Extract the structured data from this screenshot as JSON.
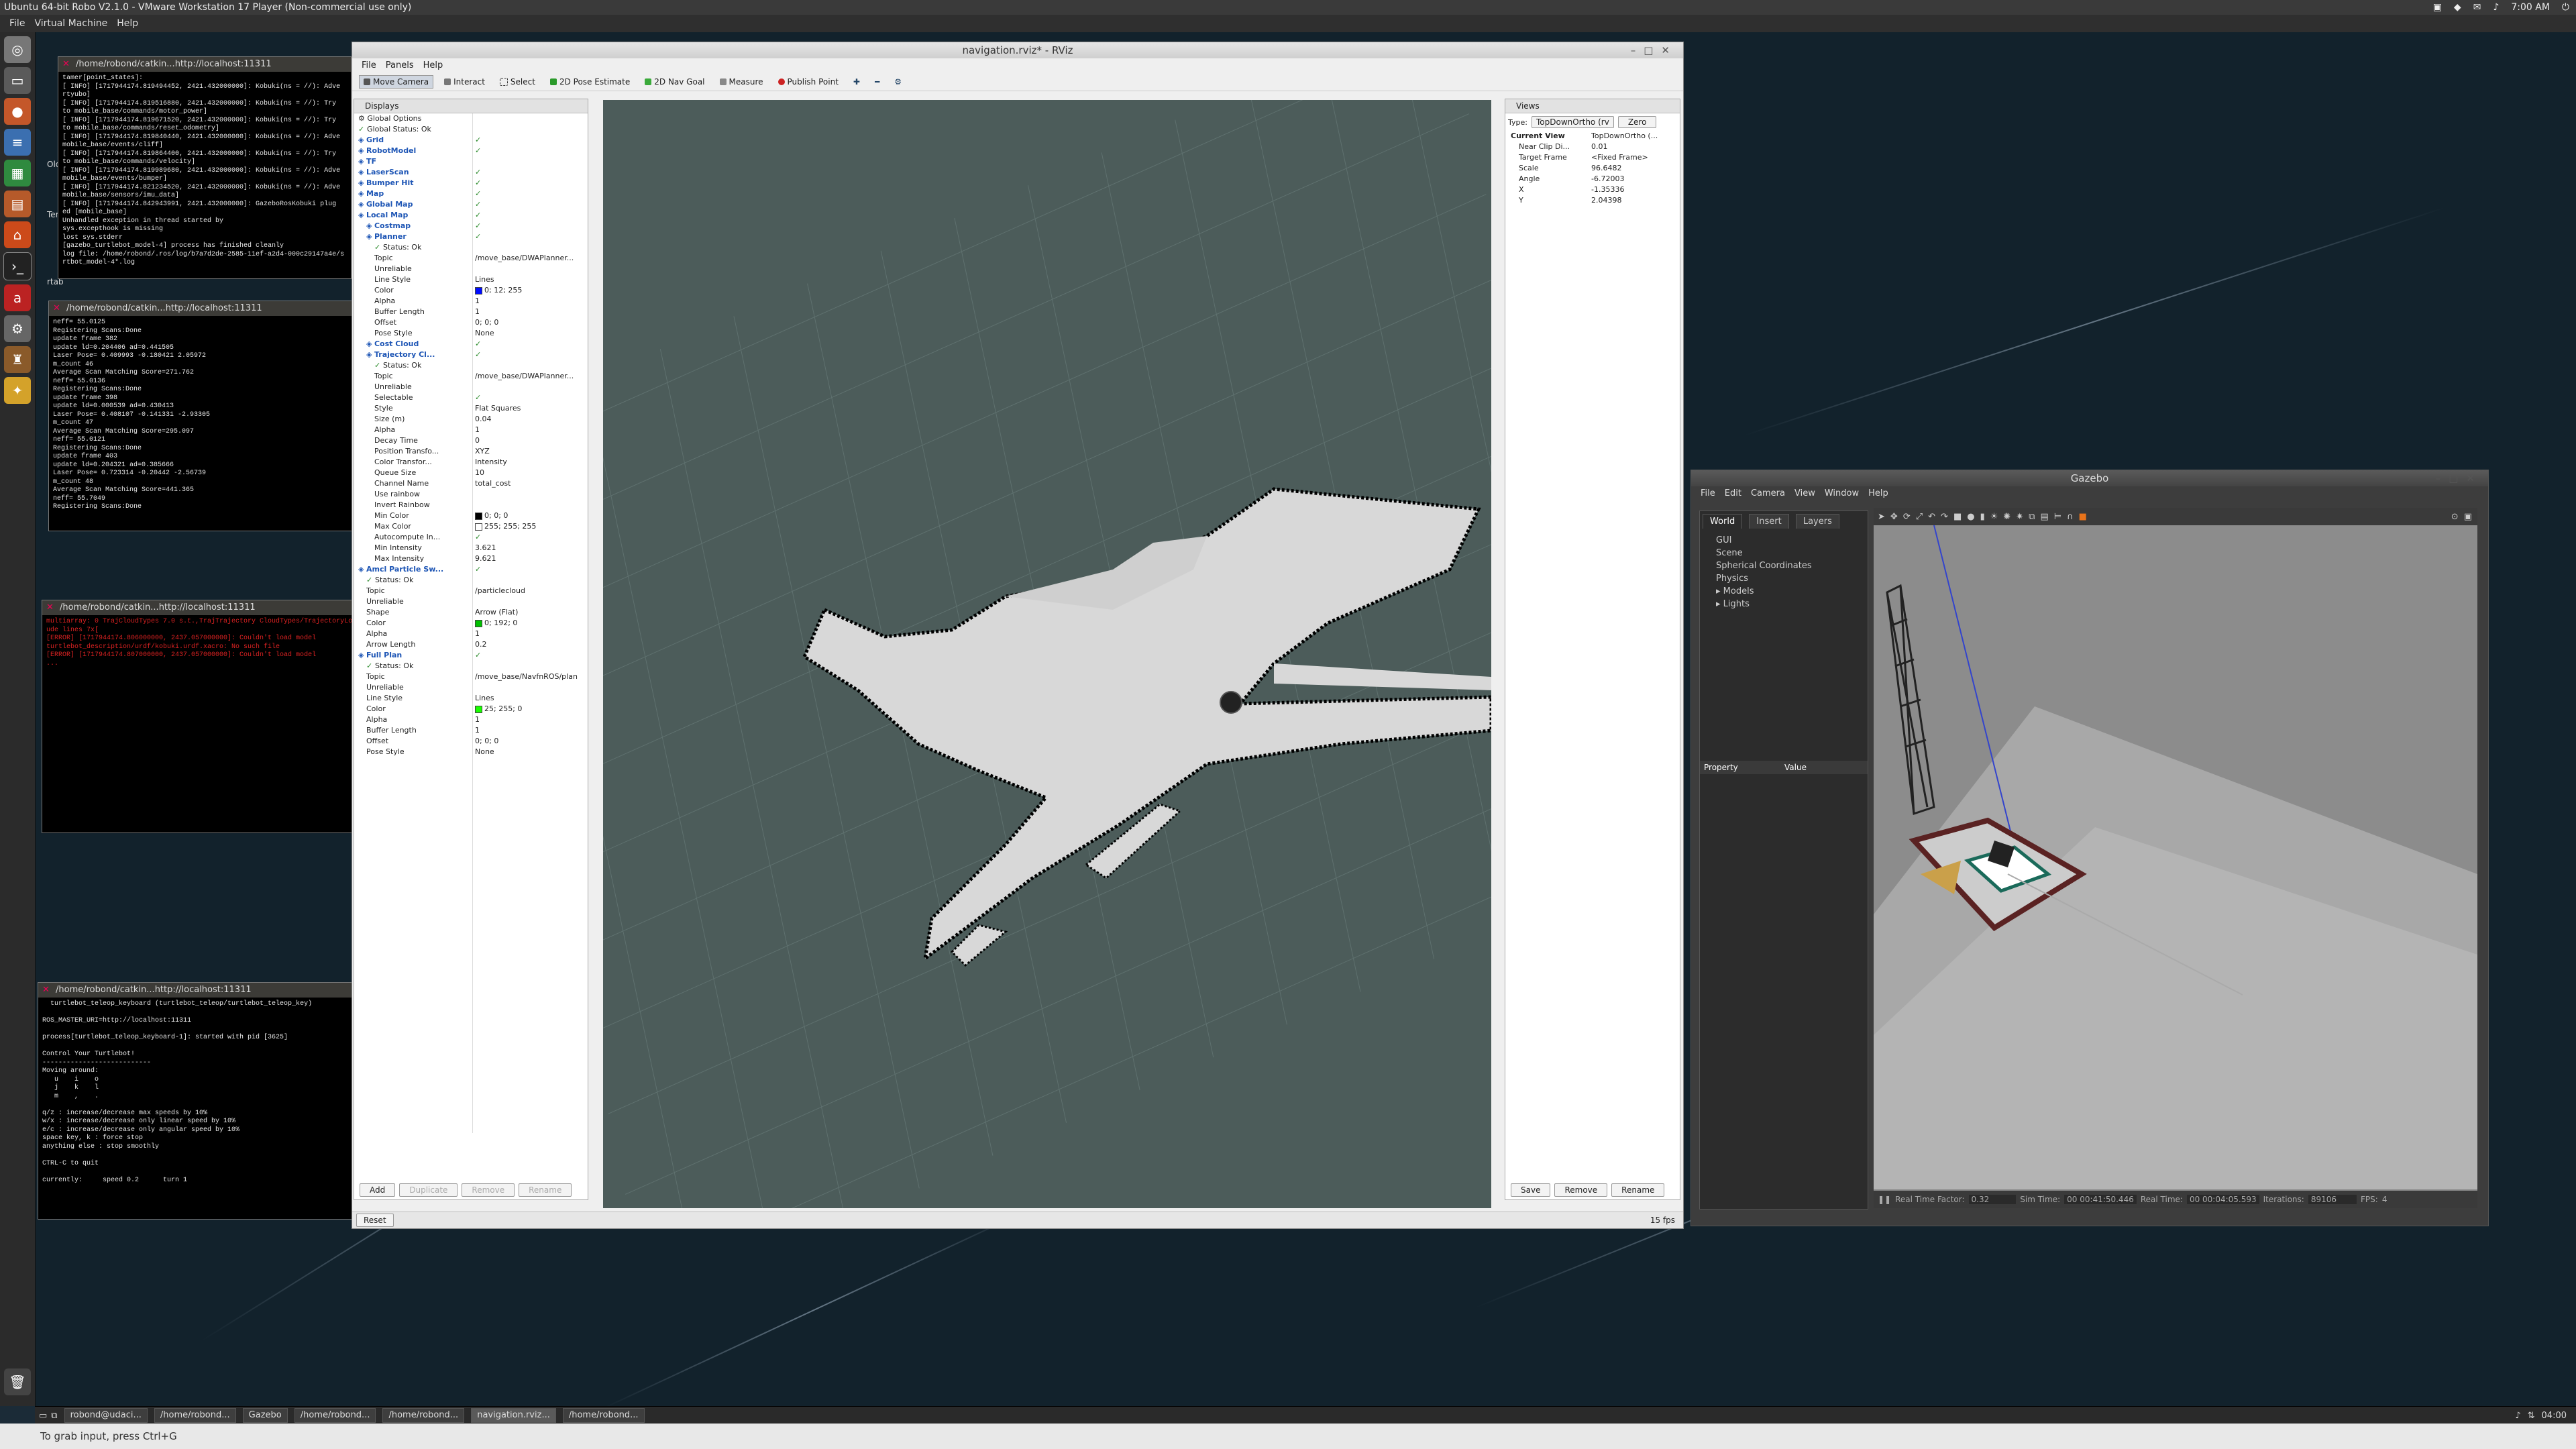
{
  "vm": {
    "title": "Ubuntu 64-bit Robo V2.1.0 - VMware Workstation 17 Player (Non-commercial use only)",
    "menu": [
      "File",
      "Virtual Machine",
      "Help"
    ],
    "clock": "7:00 AM"
  },
  "desktop": {
    "icon_labels": [
      "Old",
      "rtab",
      "Term",
      "Ty"
    ]
  },
  "terminals": [
    {
      "title": "/home/robond/catkin...http://localhost:11311",
      "lines": [
        "tamer[point_states]:",
        "[ INFO] [1717944174.819494452, 2421.432000000]: Kobuki(ns = //): Adve",
        "rtyubo]",
        "[ INFO] [1717944174.819516880, 2421.432000000]: Kobuki(ns = //): Try",
        "to mobile_base/commands/motor_power]",
        "[ INFO] [1717944174.819671520, 2421.432000000]: Kobuki(ns = //): Try",
        "to mobile_base/commands/reset_odometry]",
        "[ INFO] [1717944174.819840440, 2421.432000000]: Kobuki(ns = //): Adve",
        "mobile_base/events/cliff]",
        "[ INFO] [1717944174.819864400, 2421.432000000]: Kobuki(ns = //): Try",
        "to mobile_base/commands/velocity]",
        "[ INFO] [1717944174.819989680, 2421.432000000]: Kobuki(ns = //): Adve",
        "mobile_base/events/bumper]",
        "[ INFO] [1717944174.821234520, 2421.432000000]: Kobuki(ns = //): Adve",
        "mobile_base/sensors/imu_data]",
        "[ INFO] [1717944174.842943991, 2421.432000000]: GazeboRosKobuki plug",
        "ed [mobile_base]",
        "Unhandled exception in thread started by",
        "sys.excepthook is missing",
        "lost sys.stderr",
        "[gazebo_turtlebot_model-4] process has finished cleanly",
        "log file: /home/robond/.ros/log/b7a7d2de-2585-11ef-a2d4-000c29147a4e/s",
        "rtbot_model-4*.log"
      ]
    },
    {
      "title": "/home/robond/catkin...http://localhost:11311",
      "lines": [
        "neff= 55.0125",
        "Registering Scans:Done",
        "update frame 382",
        "update ld=0.204406 ad=0.441505",
        "Laser Pose= 0.409993 -0.180421 2.05972",
        "m_count 46",
        "Average Scan Matching Score=271.762",
        "neff= 55.0136",
        "Registering Scans:Done",
        "update frame 398",
        "update ld=0.000539 ad=0.430413",
        "Laser Pose= 0.408107 -0.141331 -2.93305",
        "m_count 47",
        "Average Scan Matching Score=295.097",
        "neff= 55.0121",
        "Registering Scans:Done",
        "update frame 403",
        "update ld=0.204321 ad=0.385666",
        "Laser Pose= 0.723314 -0.20442 -2.56739",
        "m_count 48",
        "Average Scan Matching Score=441.365",
        "neff= 55.7049",
        "Registering Scans:Done"
      ]
    },
    {
      "title": "/home/robond/catkin...http://localhost:11311",
      "lines": [
        "multiarray: 0 TrajCloudTypes 7.0 s.t.,TrajTrajectory CloudTypes/TrajectoryLocalization",
        "ude lines 7x[",
        "[ERROR] [1717944174.806000000, 2437.057000000]: Couldn't load model",
        "turtlebot_description/urdf/kobuki.urdf.xacro: No such file",
        "[ERROR] [1717944174.807000000, 2437.057000000]: Couldn't load model",
        "..."
      ]
    },
    {
      "title": "/home/robond/catkin...http://localhost:11311",
      "lines": [
        "  turtlebot_teleop_keyboard (turtlebot_teleop/turtlebot_teleop_key)",
        "",
        "ROS_MASTER_URI=http://localhost:11311",
        "",
        "process[turtlebot_teleop_keyboard-1]: started with pid [3625]",
        "",
        "Control Your Turtlebot!",
        "---------------------------",
        "Moving around:",
        "   u    i    o",
        "   j    k    l",
        "   m    ,    .",
        "",
        "q/z : increase/decrease max speeds by 10%",
        "w/x : increase/decrease only linear speed by 10%",
        "e/c : increase/decrease only angular speed by 10%",
        "space key, k : force stop",
        "anything else : stop smoothly",
        "",
        "CTRL-C to quit",
        "",
        "currently:     speed 0.2      turn 1"
      ]
    }
  ],
  "rviz": {
    "title": "navigation.rviz* - RViz",
    "menu": [
      "File",
      "Panels",
      "Help"
    ],
    "tools": [
      "Move Camera",
      "Interact",
      "Select",
      "2D Pose Estimate",
      "2D Nav Goal",
      "Measure",
      "Publish Point"
    ],
    "displays_title": "Displays",
    "tree": [
      {
        "indent": 0,
        "k": "Global Options",
        "v": "",
        "icon": "gear"
      },
      {
        "indent": 0,
        "k": "Global Status: Ok",
        "v": "",
        "icon": "check"
      },
      {
        "indent": 0,
        "k": "Grid",
        "v": "✓",
        "icon": "blue",
        "blue": true
      },
      {
        "indent": 0,
        "k": "RobotModel",
        "v": "✓",
        "icon": "blue",
        "blue": true
      },
      {
        "indent": 0,
        "k": "TF",
        "v": "",
        "icon": "blue",
        "blue": true
      },
      {
        "indent": 0,
        "k": "LaserScan",
        "v": "✓",
        "icon": "blue",
        "blue": true
      },
      {
        "indent": 0,
        "k": "Bumper Hit",
        "v": "✓",
        "icon": "blue",
        "blue": true
      },
      {
        "indent": 0,
        "k": "Map",
        "v": "✓",
        "icon": "blue",
        "blue": true
      },
      {
        "indent": 0,
        "k": "Global Map",
        "v": "✓",
        "icon": "blue",
        "blue": true
      },
      {
        "indent": 0,
        "k": "Local Map",
        "v": "✓",
        "icon": "blue",
        "blue": true
      },
      {
        "indent": 1,
        "k": "Costmap",
        "v": "✓",
        "icon": "blue",
        "blue": true
      },
      {
        "indent": 1,
        "k": "Planner",
        "v": "✓",
        "icon": "blue",
        "blue": true
      },
      {
        "indent": 2,
        "k": "Status: Ok",
        "v": "",
        "icon": "check"
      },
      {
        "indent": 2,
        "k": "Topic",
        "v": "/move_base/DWAPlanner..."
      },
      {
        "indent": 2,
        "k": "Unreliable",
        "v": ""
      },
      {
        "indent": 2,
        "k": "Line Style",
        "v": "Lines"
      },
      {
        "indent": 2,
        "k": "Color",
        "v": "0; 12; 255",
        "swatch": "#000cff"
      },
      {
        "indent": 2,
        "k": "Alpha",
        "v": "1"
      },
      {
        "indent": 2,
        "k": "Buffer Length",
        "v": "1"
      },
      {
        "indent": 2,
        "k": "Offset",
        "v": "0; 0; 0"
      },
      {
        "indent": 2,
        "k": "Pose Style",
        "v": "None"
      },
      {
        "indent": 1,
        "k": "Cost Cloud",
        "v": "✓",
        "icon": "blue",
        "blue": true
      },
      {
        "indent": 1,
        "k": "Trajectory Cl...",
        "v": "✓",
        "icon": "blue",
        "blue": true
      },
      {
        "indent": 2,
        "k": "Status: Ok",
        "v": "",
        "icon": "check"
      },
      {
        "indent": 2,
        "k": "Topic",
        "v": "/move_base/DWAPlanner..."
      },
      {
        "indent": 2,
        "k": "Unreliable",
        "v": ""
      },
      {
        "indent": 2,
        "k": "Selectable",
        "v": "✓"
      },
      {
        "indent": 2,
        "k": "Style",
        "v": "Flat Squares"
      },
      {
        "indent": 2,
        "k": "Size (m)",
        "v": "0.04"
      },
      {
        "indent": 2,
        "k": "Alpha",
        "v": "1"
      },
      {
        "indent": 2,
        "k": "Decay Time",
        "v": "0"
      },
      {
        "indent": 2,
        "k": "Position Transfo...",
        "v": "XYZ"
      },
      {
        "indent": 2,
        "k": "Color Transfor...",
        "v": "Intensity"
      },
      {
        "indent": 2,
        "k": "Queue Size",
        "v": "10"
      },
      {
        "indent": 2,
        "k": "Channel Name",
        "v": "total_cost"
      },
      {
        "indent": 2,
        "k": "Use rainbow",
        "v": ""
      },
      {
        "indent": 2,
        "k": "Invert Rainbow",
        "v": ""
      },
      {
        "indent": 2,
        "k": "Min Color",
        "v": "0; 0; 0",
        "swatch": "#000000"
      },
      {
        "indent": 2,
        "k": "Max Color",
        "v": "255; 255; 255",
        "swatch": "#ffffff"
      },
      {
        "indent": 2,
        "k": "Autocompute In...",
        "v": "✓"
      },
      {
        "indent": 2,
        "k": "Min Intensity",
        "v": "3.621"
      },
      {
        "indent": 2,
        "k": "Max Intensity",
        "v": "9.621"
      },
      {
        "indent": 0,
        "k": "Amcl Particle Sw...",
        "v": "✓",
        "icon": "blue",
        "blue": true
      },
      {
        "indent": 1,
        "k": "Status: Ok",
        "v": "",
        "icon": "check"
      },
      {
        "indent": 1,
        "k": "Topic",
        "v": "/particlecloud"
      },
      {
        "indent": 1,
        "k": "Unreliable",
        "v": ""
      },
      {
        "indent": 1,
        "k": "Shape",
        "v": "Arrow (Flat)"
      },
      {
        "indent": 1,
        "k": "Color",
        "v": "0; 192; 0",
        "swatch": "#00c000"
      },
      {
        "indent": 1,
        "k": "Alpha",
        "v": "1"
      },
      {
        "indent": 1,
        "k": "Arrow Length",
        "v": "0.2"
      },
      {
        "indent": 0,
        "k": "Full Plan",
        "v": "✓",
        "icon": "blue",
        "blue": true
      },
      {
        "indent": 1,
        "k": "Status: Ok",
        "v": "",
        "icon": "check"
      },
      {
        "indent": 1,
        "k": "Topic",
        "v": "/move_base/NavfnROS/plan"
      },
      {
        "indent": 1,
        "k": "Unreliable",
        "v": ""
      },
      {
        "indent": 1,
        "k": "Line Style",
        "v": "Lines"
      },
      {
        "indent": 1,
        "k": "Color",
        "v": "25; 255; 0",
        "swatch": "#19ff00"
      },
      {
        "indent": 1,
        "k": "Alpha",
        "v": "1"
      },
      {
        "indent": 1,
        "k": "Buffer Length",
        "v": "1"
      },
      {
        "indent": 1,
        "k": "Offset",
        "v": "0; 0; 0"
      },
      {
        "indent": 1,
        "k": "Pose Style",
        "v": "None"
      }
    ],
    "display_buttons": {
      "add": "Add",
      "duplicate": "Duplicate",
      "remove": "Remove",
      "rename": "Rename"
    },
    "views": {
      "title": "Views",
      "type_label": "Type:",
      "type_value": "TopDownOrtho (rv",
      "zero": "Zero",
      "rows": [
        {
          "k": "Current View",
          "v": "TopDownOrtho (..."
        },
        {
          "k": "Near Clip Di...",
          "v": "0.01"
        },
        {
          "k": "Target Frame",
          "v": "<Fixed Frame>"
        },
        {
          "k": "Scale",
          "v": "96.6482"
        },
        {
          "k": "Angle",
          "v": "-6.72003"
        },
        {
          "k": "X",
          "v": "-1.35336"
        },
        {
          "k": "Y",
          "v": "2.04398"
        }
      ],
      "buttons": {
        "save": "Save",
        "remove": "Remove",
        "rename": "Rename"
      }
    },
    "reset": "Reset",
    "fps": "15 fps"
  },
  "gazebo": {
    "title": "Gazebo",
    "menu": [
      "File",
      "Edit",
      "Camera",
      "View",
      "Window",
      "Help"
    ],
    "tabs": [
      "World",
      "Insert",
      "Layers"
    ],
    "world_items": [
      "GUI",
      "Scene",
      "Spherical Coordinates",
      "Physics",
      "Models",
      "Lights"
    ],
    "prop_headers": {
      "property": "Property",
      "value": "Value"
    },
    "status": {
      "rtf_label": "Real Time Factor:",
      "rtf": "0.32",
      "sim_label": "Sim Time:",
      "sim": "00 00:41:50.446",
      "real_label": "Real Time:",
      "real": "00 00:04:05.593",
      "iter_label": "Iterations:",
      "iter": "89106",
      "fps_label": "FPS:",
      "fps": "4"
    }
  },
  "taskbar": {
    "items": [
      "robond@udaci...",
      "/home/robond...",
      "Gazebo",
      "/home/robond...",
      "/home/robond...",
      "navigation.rviz...",
      "/home/robond..."
    ],
    "time": "04:00"
  },
  "grab_hint": "To grab input, press Ctrl+G",
  "colors": {
    "rviz_bg": "#4c5c5a",
    "free_space": "#d8d8d8",
    "walls": "#000000",
    "gz_sky": "#8c8c8c"
  }
}
